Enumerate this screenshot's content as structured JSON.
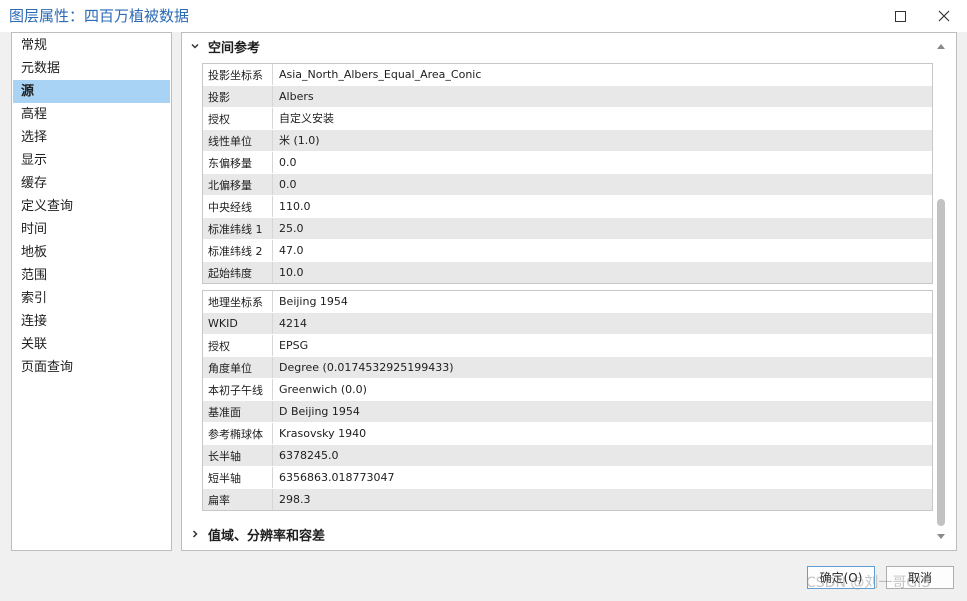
{
  "window": {
    "title": "图层属性：四百万植被数据"
  },
  "nav": {
    "items": [
      {
        "label": "常规"
      },
      {
        "label": "元数据"
      },
      {
        "label": "源"
      },
      {
        "label": "高程"
      },
      {
        "label": "选择"
      },
      {
        "label": "显示"
      },
      {
        "label": "缓存"
      },
      {
        "label": "定义查询"
      },
      {
        "label": "时间"
      },
      {
        "label": "地板"
      },
      {
        "label": "范围"
      },
      {
        "label": "索引"
      },
      {
        "label": "连接"
      },
      {
        "label": "关联"
      },
      {
        "label": "页面查询"
      }
    ],
    "active_index": 2
  },
  "section_spatial": {
    "title": "空间参考",
    "projected": [
      {
        "label": "投影坐标系",
        "value": "Asia_North_Albers_Equal_Area_Conic"
      },
      {
        "label": "投影",
        "value": "Albers"
      },
      {
        "label": "授权",
        "value": "自定义安装"
      },
      {
        "label": "线性单位",
        "value": "米 (1.0)"
      },
      {
        "label": "东偏移量",
        "value": "0.0"
      },
      {
        "label": "北偏移量",
        "value": "0.0"
      },
      {
        "label": "中央经线",
        "value": "110.0"
      },
      {
        "label": "标准纬线 1",
        "value": "25.0"
      },
      {
        "label": "标准纬线 2",
        "value": "47.0"
      },
      {
        "label": "起始纬度",
        "value": "10.0"
      }
    ],
    "geographic": [
      {
        "label": "地理坐标系",
        "value": "Beijing 1954"
      },
      {
        "label": "WKID",
        "value": "4214"
      },
      {
        "label": "授权",
        "value": "EPSG"
      },
      {
        "label": "角度单位",
        "value": "Degree (0.0174532925199433)"
      },
      {
        "label": "本初子午线",
        "value": "Greenwich (0.0)"
      },
      {
        "label": "基准面",
        "value": "D Beijing 1954"
      },
      {
        "label": "参考椭球体",
        "value": "Krasovsky 1940"
      },
      {
        "label": "长半轴",
        "value": "6378245.0"
      },
      {
        "label": "短半轴",
        "value": "6356863.018773047"
      },
      {
        "label": "扁率",
        "value": "298.3"
      }
    ]
  },
  "section_domain": {
    "title": "值域、分辨率和容差"
  },
  "footer": {
    "ok_label": "确定(O)",
    "cancel_label": "取消"
  },
  "watermark": {
    "text": "CSDN @刘一哥GIS"
  },
  "colors": {
    "accent": "#2b6ab5",
    "selected": "#a9d3f5",
    "alt_row": "#e8e8e8"
  }
}
